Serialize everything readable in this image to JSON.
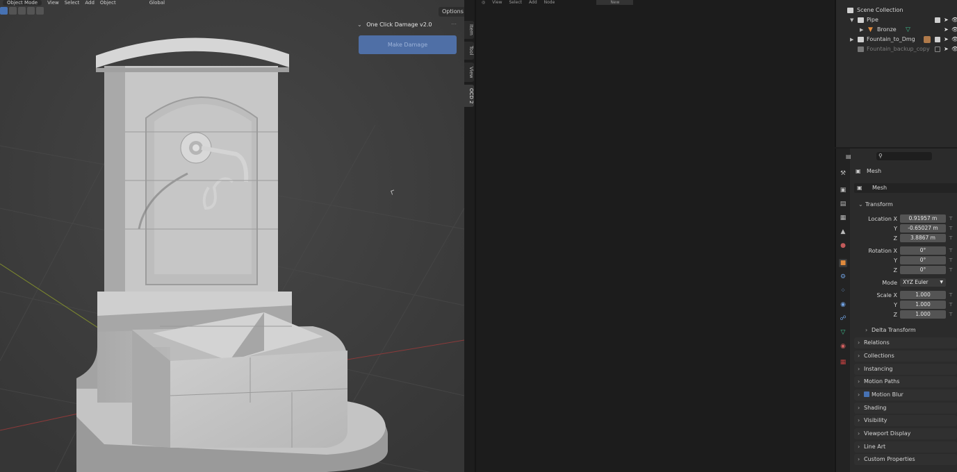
{
  "viewport": {
    "mode_label": "Object Mode",
    "menu": [
      "View",
      "Select",
      "Add",
      "Object"
    ],
    "orientation": "Global",
    "options_label": "Options",
    "panel": {
      "title": "One Click Damage v2.0",
      "button_label": "Make Damage"
    },
    "side_tabs": [
      "Item",
      "Tool",
      "View",
      "OCD 2"
    ]
  },
  "middle_editor": {
    "menu": [
      "View",
      "Select",
      "Add",
      "Node"
    ],
    "new_label": "New"
  },
  "outliner": {
    "rows": [
      {
        "label": "Scene Collection",
        "level": 0,
        "icon": "collection-icon",
        "color": "#d8d8d8"
      },
      {
        "label": "Pipe",
        "level": 1,
        "icon": "collection-icon",
        "color": "#d8d8d8",
        "checked": true
      },
      {
        "label": "Bronze",
        "level": 2,
        "icon": "object-icon",
        "color": "#e08a3c"
      },
      {
        "label": "Fountain_to_Dmg",
        "level": 1,
        "icon": "collection-icon",
        "color": "#d8d8d8",
        "checked": true
      },
      {
        "label": "Fountain_backup_copy",
        "level": 1,
        "icon": "collection-icon",
        "color": "#7d7d7d",
        "checked": false
      }
    ]
  },
  "properties": {
    "breadcrumb": "Mesh",
    "datablock": "Mesh",
    "transform": {
      "title": "Transform",
      "location": {
        "label": "Location X",
        "x": "0.91957 m",
        "y": "-0.65027 m",
        "z": "3.8867 m"
      },
      "rotation": {
        "label": "Rotation X",
        "x": "0°",
        "y": "0°",
        "z": "0°"
      },
      "mode_label": "Mode",
      "mode_value": "XYZ Euler",
      "scale": {
        "label": "Scale X",
        "x": "1.000",
        "y": "1.000",
        "z": "1.000"
      },
      "axis_y": "Y",
      "axis_z": "Z",
      "delta": "Delta Transform"
    },
    "sections": [
      "Relations",
      "Collections",
      "Instancing",
      "Motion Paths",
      "Motion Blur",
      "Shading",
      "Visibility",
      "Viewport Display",
      "Line Art",
      "Custom Properties"
    ]
  },
  "colors": {
    "accent": "#4772b3",
    "button": "#4f6fa6",
    "viewport_bg": "#3d3d3d"
  }
}
